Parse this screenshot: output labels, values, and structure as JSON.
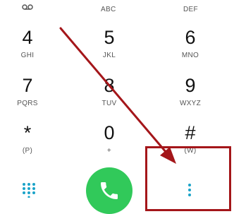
{
  "top_row": {
    "left_icon": "voicemail-icon",
    "middle_letters": "ABC",
    "right_letters": "DEF"
  },
  "keys": [
    {
      "digit": "4",
      "letters": "GHI"
    },
    {
      "digit": "5",
      "letters": "JKL"
    },
    {
      "digit": "6",
      "letters": "MNO"
    },
    {
      "digit": "7",
      "letters": "PQRS"
    },
    {
      "digit": "8",
      "letters": "TUV"
    },
    {
      "digit": "9",
      "letters": "WXYZ"
    },
    {
      "digit": "*",
      "letters": "(P)"
    },
    {
      "digit": "0",
      "letters": "+"
    },
    {
      "digit": "#",
      "letters": "(W)"
    }
  ],
  "bottom_bar": {
    "dialpad_icon": "dialpad-grid-icon",
    "call_icon": "phone-icon",
    "more_icon": "more-vertical-icon"
  },
  "colors": {
    "call_green": "#31c95a",
    "accent_teal": "#1aa3c8",
    "annotation_red": "#a4161a"
  }
}
